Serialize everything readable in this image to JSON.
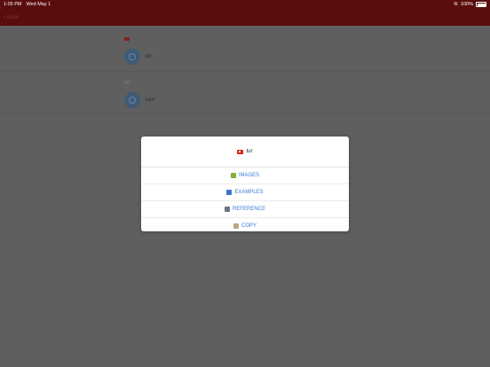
{
  "status_bar": {
    "time": "1:05 PM",
    "date": "Wed May 1",
    "wifi_icon": "wifi-icon",
    "battery": "100%"
  },
  "nav": {
    "back_label": "Back",
    "title": "",
    "action_label": ""
  },
  "list": {
    "sections": [
      {
        "header": "",
        "row_text": "tür"
      },
      {
        "header": "",
        "row_text": "tour"
      }
    ]
  },
  "dialog": {
    "word": "tur",
    "options": [
      {
        "label": "IMAGES",
        "icon": "images-icon"
      },
      {
        "label": "EXAMPLES",
        "icon": "book-icon"
      },
      {
        "label": "REFERENCE",
        "icon": "reference-icon"
      },
      {
        "label": "COPY",
        "icon": "copy-icon"
      }
    ]
  },
  "colors": {
    "nav_bg": "#5a0d0d",
    "link": "#3a78d4"
  }
}
